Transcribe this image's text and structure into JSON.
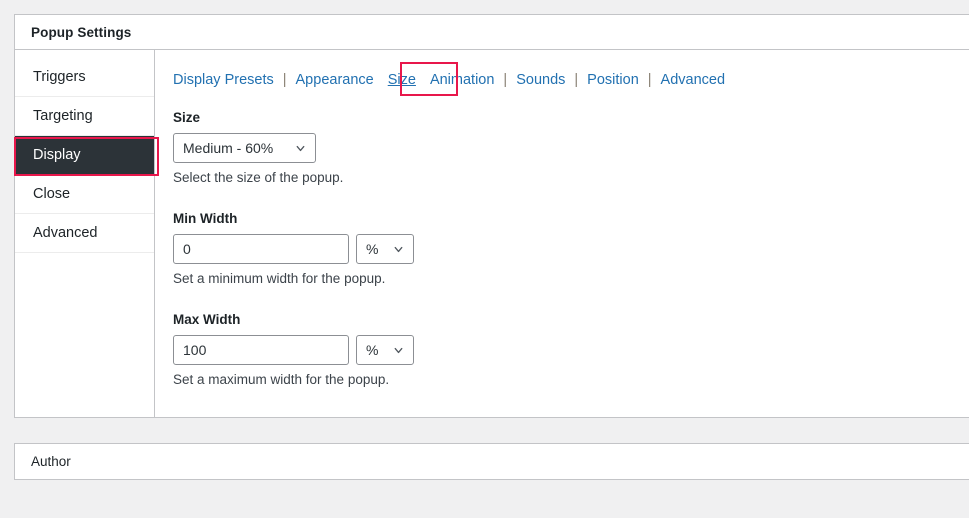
{
  "page": {
    "background_color": "#f0f0f1",
    "accent_color": "#2271b1",
    "annotation_color": "#e8174b",
    "active_nav_bg": "#2c3338"
  },
  "settings_panel": {
    "title": "Popup Settings",
    "nav": {
      "items": [
        {
          "label": "Triggers",
          "active": false
        },
        {
          "label": "Targeting",
          "active": false
        },
        {
          "label": "Display",
          "active": true
        },
        {
          "label": "Close",
          "active": false
        },
        {
          "label": "Advanced",
          "active": false
        }
      ]
    },
    "tabs": {
      "items": [
        {
          "label": "Display Presets",
          "current": false
        },
        {
          "label": "Appearance",
          "current": false
        },
        {
          "label": "Size",
          "current": true
        },
        {
          "label": "Animation",
          "current": false
        },
        {
          "label": "Sounds",
          "current": false
        },
        {
          "label": "Position",
          "current": false
        },
        {
          "label": "Advanced",
          "current": false
        }
      ],
      "separator": "|"
    },
    "fields": {
      "size": {
        "label": "Size",
        "value": "Medium - 60%",
        "description": "Select the size of the popup.",
        "icon": "chevron-down-icon"
      },
      "min_width": {
        "label": "Min Width",
        "value": "0",
        "placeholder": "",
        "unit": "%",
        "description": "Set a minimum width for the popup.",
        "icon": "chevron-down-icon"
      },
      "max_width": {
        "label": "Max Width",
        "value": "100",
        "placeholder": "",
        "unit": "%",
        "description": "Set a maximum width for the popup.",
        "icon": "chevron-down-icon"
      }
    }
  },
  "author_panel": {
    "title": "Author"
  }
}
